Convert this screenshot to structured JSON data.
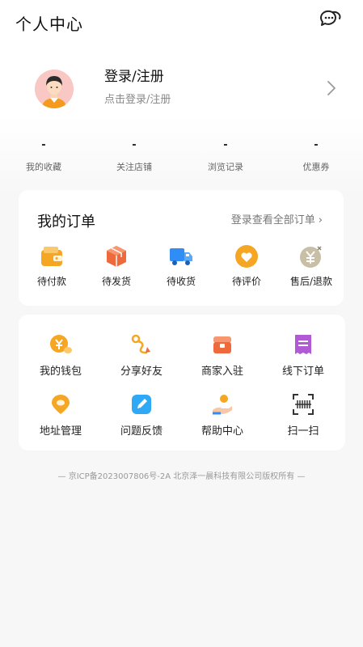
{
  "header": {
    "title": "个人中心",
    "message_icon": "chat-bubble-icon"
  },
  "profile": {
    "login_title": "登录/注册",
    "login_subtitle": "点击登录/注册",
    "avatar_icon": "user-avatar-icon",
    "arrow_icon": "chevron-right-icon"
  },
  "stats": [
    {
      "value": "-",
      "label": "我的收藏"
    },
    {
      "value": "-",
      "label": "关注店铺"
    },
    {
      "value": "-",
      "label": "浏览记录"
    },
    {
      "value": "-",
      "label": "优惠券"
    }
  ],
  "orders": {
    "title": "我的订单",
    "view_all": "登录查看全部订单",
    "items": [
      {
        "label": "待付款",
        "icon": "wallet-icon",
        "color": "#f5a623"
      },
      {
        "label": "待发货",
        "icon": "package-icon",
        "color": "#ee6a3c"
      },
      {
        "label": "待收货",
        "icon": "truck-icon",
        "color": "#2f8df5"
      },
      {
        "label": "待评价",
        "icon": "heart-icon",
        "color": "#f5a623"
      },
      {
        "label": "售后/退款",
        "icon": "refund-icon",
        "color": "#c9bfa6"
      }
    ]
  },
  "tools": [
    {
      "label": "我的钱包",
      "icon": "wallet-coin-icon",
      "color": "#f5a623"
    },
    {
      "label": "分享好友",
      "icon": "share-route-icon",
      "color": "#f5a623"
    },
    {
      "label": "商家入驻",
      "icon": "merchant-icon",
      "color": "#ee6a3c"
    },
    {
      "label": "线下订单",
      "icon": "receipt-icon",
      "color": "#b25ad6"
    },
    {
      "label": "地址管理",
      "icon": "location-icon",
      "color": "#f5a623"
    },
    {
      "label": "问题反馈",
      "icon": "feedback-edit-icon",
      "color": "#2fa8f5"
    },
    {
      "label": "帮助中心",
      "icon": "help-hand-icon",
      "color": "#f5a623"
    },
    {
      "label": "扫一扫",
      "icon": "scan-icon",
      "color": "#333333"
    }
  ],
  "footer": {
    "text": "— 京ICP备2023007806号-2A 北京泽一晨科技有限公司版权所有 —"
  },
  "colors": {
    "background": "#f7f7f7",
    "card": "#ffffff",
    "accent_orange": "#f5a623"
  }
}
